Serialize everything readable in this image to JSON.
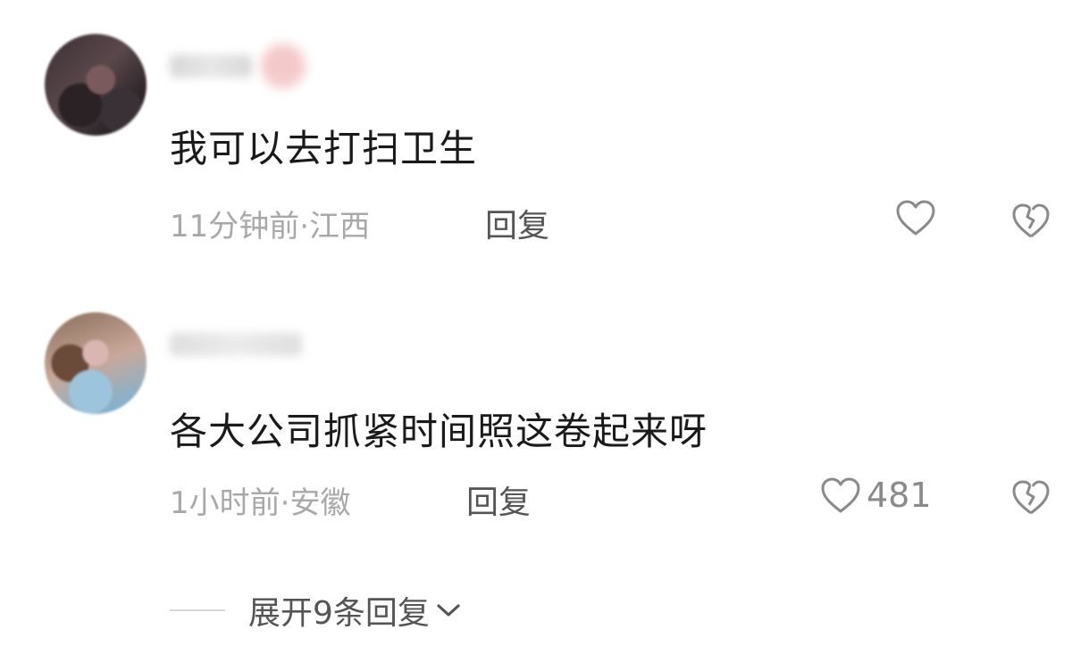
{
  "comments": [
    {
      "text": "我可以去打扫卫生",
      "meta": "11分钟前·江西",
      "reply_label": "回复",
      "like_count": "",
      "icons": [
        "heart-outline-icon",
        "broken-heart-icon"
      ]
    },
    {
      "text": "各大公司抓紧时间照这卷起来呀",
      "meta": "1小时前·安徽",
      "reply_label": "回复",
      "like_count": "481",
      "icons": [
        "heart-outline-icon",
        "broken-heart-icon"
      ]
    }
  ],
  "expand": {
    "label": "展开9条回复",
    "icon": "chevron-down-icon"
  },
  "colors": {
    "text": "#1a1a1a",
    "meta": "#a8a8a8",
    "action": "#555555",
    "icon": "#8a8a8a"
  }
}
